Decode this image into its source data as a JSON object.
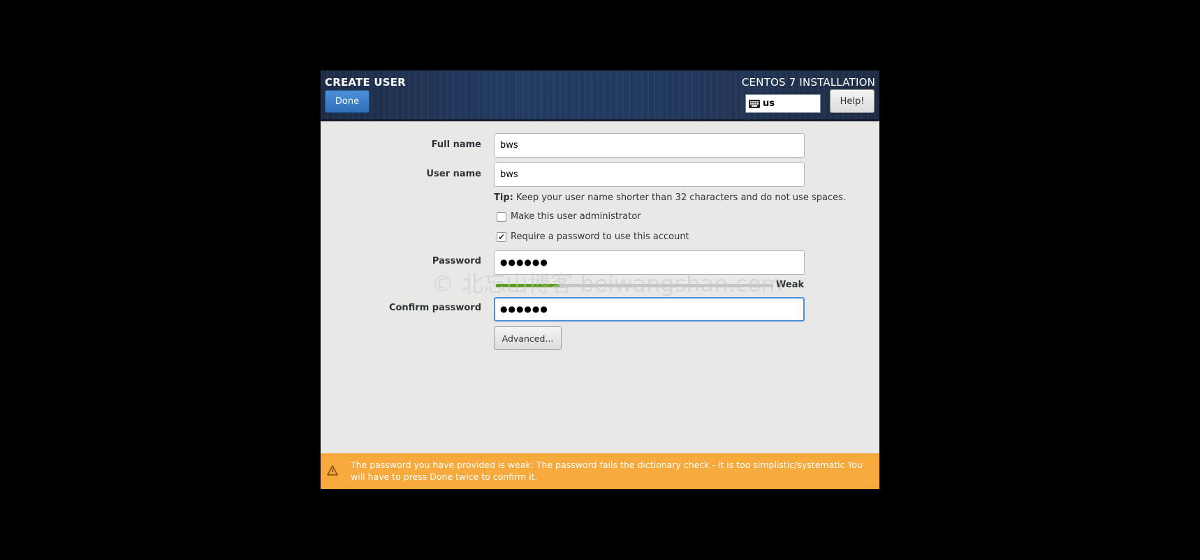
{
  "header": {
    "spoke_title": "CREATE USER",
    "done_label": "Done",
    "product_title": "CENTOS 7 INSTALLATION",
    "keyboard_layout": "us",
    "help_label": "Help!"
  },
  "form": {
    "full_name": {
      "label": "Full name",
      "value": "bws"
    },
    "user_name": {
      "label": "User name",
      "value": "bws"
    },
    "tip": {
      "prefix": "Tip:",
      "text": " Keep your user name shorter than 32 characters and do not use spaces."
    },
    "admin_checkbox": {
      "label": "Make this user administrator",
      "checked": false
    },
    "require_password_checkbox": {
      "label": "Require a password to use this account",
      "checked": true
    },
    "password": {
      "label": "Password",
      "masked": "●●●●●●"
    },
    "strength": {
      "label": "Weak",
      "level": 0.23,
      "color": "#5e9b1e"
    },
    "confirm_password": {
      "label": "Confirm password",
      "masked": "●●●●●●"
    },
    "advanced_label": "Advanced..."
  },
  "warning": {
    "text": "The password you have provided is weak: The password fails the dictionary check - it is too simplistic/systematic You will have to press Done twice to confirm it.",
    "color": "#f7a93b"
  },
  "watermark": "© 北忘山博客 beiwangshan.com",
  "colors": {
    "accent": "#4a90d9",
    "header_bg": "#223b63"
  }
}
